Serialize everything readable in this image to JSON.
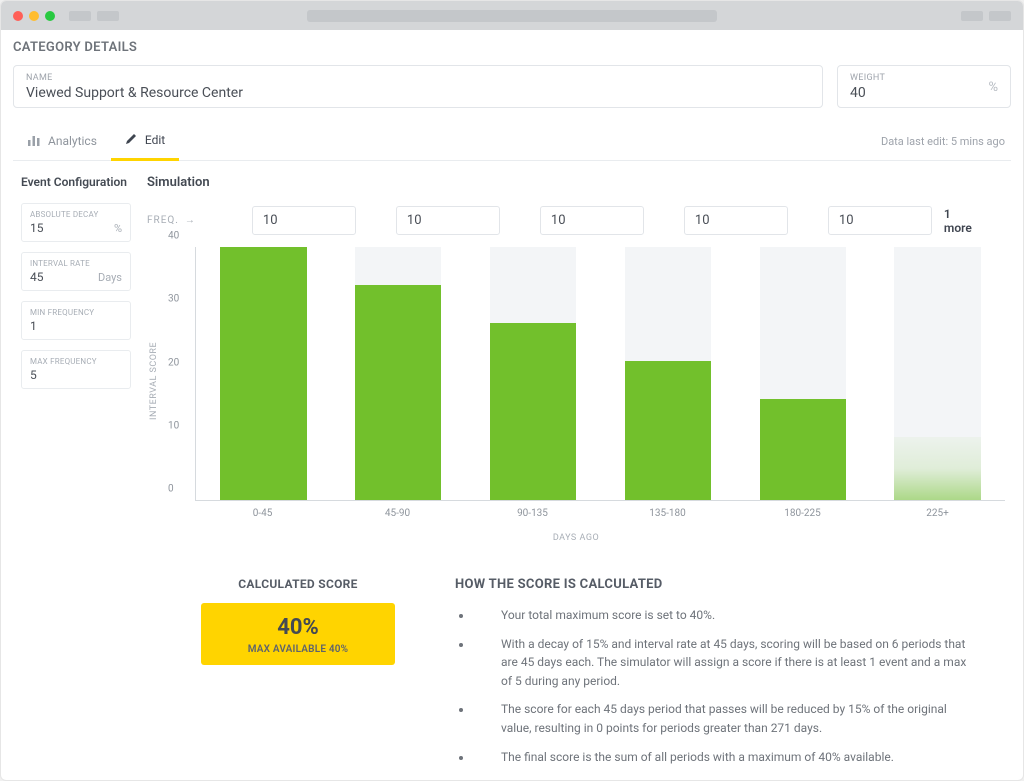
{
  "header": {
    "section_title": "CATEGORY DETAILS"
  },
  "form": {
    "name_label": "NAME",
    "name_value": "Viewed Support & Resource Center",
    "weight_label": "WEIGHT",
    "weight_value": "40",
    "weight_suffix": "%"
  },
  "tabs": {
    "analytics": "Analytics",
    "edit": "Edit",
    "meta": "Data last edit: 5 mins ago"
  },
  "sidebar": {
    "title": "Event Configuration",
    "abs_decay_label": "ABSOLUTE DECAY",
    "abs_decay_value": "15",
    "abs_decay_suffix": "%",
    "interval_label": "INTERVAL RATE",
    "interval_value": "45",
    "interval_suffix": "Days",
    "min_freq_label": "MIN FREQUENCY",
    "min_freq_value": "1",
    "max_freq_label": "MAX FREQUENCY",
    "max_freq_value": "5"
  },
  "sim": {
    "title": "Simulation",
    "freq_label": "FREQ.",
    "inputs": [
      "10",
      "10",
      "10",
      "10",
      "10"
    ],
    "more": "1 more"
  },
  "chart_data": {
    "type": "bar",
    "categories": [
      "0-45",
      "45-90",
      "90-135",
      "135-180",
      "180-225",
      "225+"
    ],
    "values": [
      40,
      34,
      28,
      22,
      16,
      10
    ],
    "yticks": [
      0,
      10,
      20,
      30,
      40
    ],
    "ylim": [
      0,
      40
    ],
    "ylabel": "INTERVAL SCORE",
    "xlabel": "DAYS AGO",
    "partial_last": true
  },
  "calc": {
    "title": "CALCULATED SCORE",
    "pct": "40%",
    "sub": "MAX AVAILABLE 40%"
  },
  "explain": {
    "title": "HOW THE SCORE IS CALCULATED",
    "items": [
      "Your total maximum score is set to 40%.",
      "With a decay of 15% and interval rate at 45 days, scoring will be based on 6 periods that are 45 days each. The simulator will assign a score if there is at least 1 event and a max of 5 during any period.",
      "The score for each 45 days period that passes will be reduced by 15% of the original value, resulting in 0 points for periods greater than 271 days.",
      "The final score is the sum of all periods with a maximum of 40% available."
    ]
  }
}
